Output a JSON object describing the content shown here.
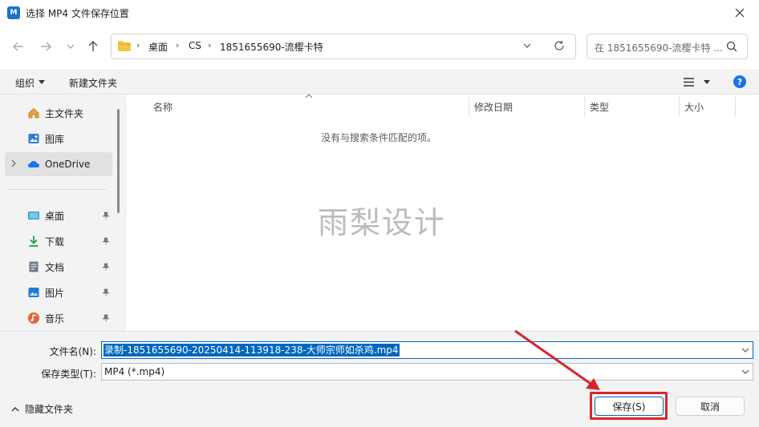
{
  "window": {
    "title": "选择 MP4 文件保存位置",
    "app_icon_text": "M"
  },
  "address": {
    "crumbs": [
      "桌面",
      "CS",
      "1851655690-流樱卡特"
    ]
  },
  "search": {
    "placeholder": "在 1851655690-流樱卡特 ..."
  },
  "toolbar": {
    "organize_label": "组织",
    "new_folder_label": "新建文件夹"
  },
  "navpane": {
    "items": [
      {
        "label": "主文件夹",
        "icon": "home-icon"
      },
      {
        "label": "图库",
        "icon": "gallery-icon"
      },
      {
        "label": "OneDrive",
        "icon": "cloud-icon"
      },
      {
        "label": "桌面",
        "icon": "desktop-icon"
      },
      {
        "label": "下载",
        "icon": "download-icon"
      },
      {
        "label": "文档",
        "icon": "document-icon"
      },
      {
        "label": "图片",
        "icon": "pictures-icon"
      },
      {
        "label": "音乐",
        "icon": "music-icon"
      }
    ]
  },
  "columns": {
    "name": "名称",
    "modified": "修改日期",
    "type": "类型",
    "size": "大小"
  },
  "main": {
    "empty_message": "没有与搜索条件匹配的项。",
    "watermark": "雨梨设计"
  },
  "form": {
    "filename_label": "文件名(N):",
    "filename_value": "录制-1851655690-20250414-113918-238-大师宗师如杀鸡.mp4",
    "filetype_label": "保存类型(T):",
    "filetype_value": "MP4 (*.mp4)"
  },
  "footer": {
    "hide_folders_label": "隐藏文件夹",
    "save_label": "保存(S)",
    "cancel_label": "取消"
  },
  "colors": {
    "accent": "#0067c0",
    "annotation_red": "#d9262a"
  }
}
